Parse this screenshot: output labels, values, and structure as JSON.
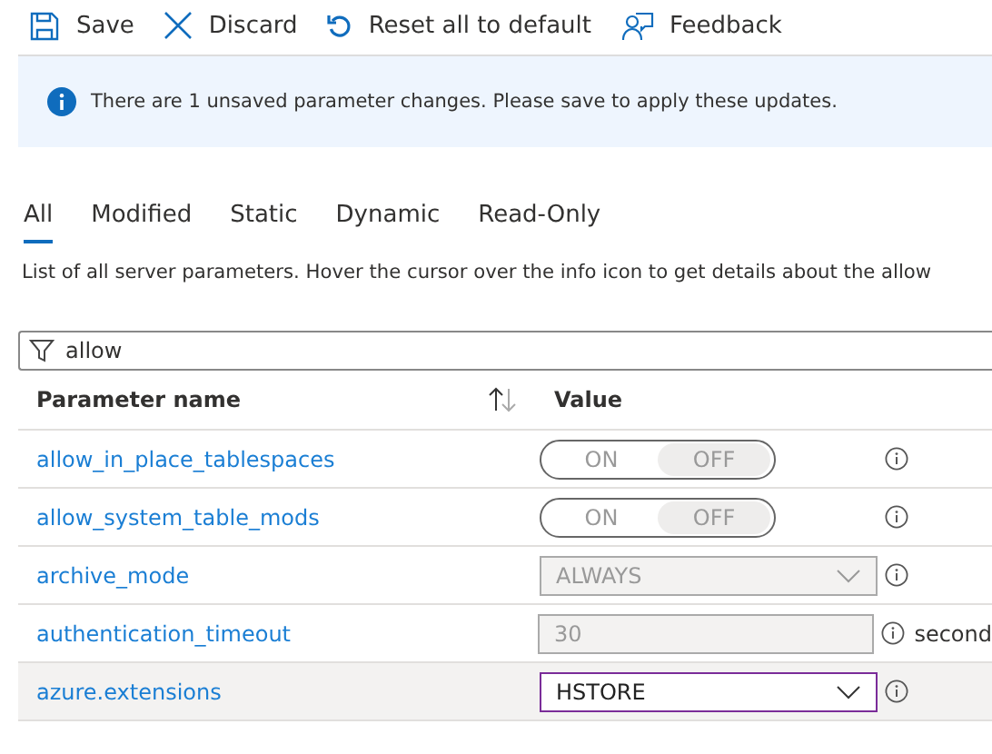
{
  "toolbar": [
    {
      "kind": "save",
      "label": "Save"
    },
    {
      "kind": "discard",
      "label": "Discard"
    },
    {
      "kind": "reset",
      "label": "Reset all to default"
    },
    {
      "kind": "feedback",
      "label": "Feedback"
    }
  ],
  "notice": {
    "text": "There are 1 unsaved parameter changes.  Please save to apply these updates."
  },
  "tabs": [
    {
      "label": "All",
      "selected": true
    },
    {
      "label": "Modified",
      "selected": false
    },
    {
      "label": "Static",
      "selected": false
    },
    {
      "label": "Dynamic",
      "selected": false
    },
    {
      "label": "Read-Only",
      "selected": false
    }
  ],
  "description": "List of all server parameters. Hover the cursor over the info icon to get details about the allow",
  "filter": {
    "value": "allow"
  },
  "table": {
    "columns": [
      "Parameter name",
      "Value"
    ],
    "rows": [
      {
        "name": "allow_in_place_tablespaces",
        "kind": "toggle",
        "on_label": "ON",
        "off_label": "OFF",
        "on": false,
        "selected": false
      },
      {
        "name": "allow_system_table_mods",
        "kind": "toggle",
        "on_label": "ON",
        "off_label": "OFF",
        "on": false,
        "selected": false
      },
      {
        "name": "archive_mode",
        "kind": "dropdown",
        "value": "ALWAYS",
        "disabled": true,
        "selected": false
      },
      {
        "name": "authentication_timeout",
        "kind": "number",
        "value": "30",
        "disabled": true,
        "unit": "second",
        "selected": false
      },
      {
        "name": "azure.extensions",
        "kind": "dropdown",
        "value": "HSTORE",
        "disabled": false,
        "selected": true
      }
    ]
  }
}
